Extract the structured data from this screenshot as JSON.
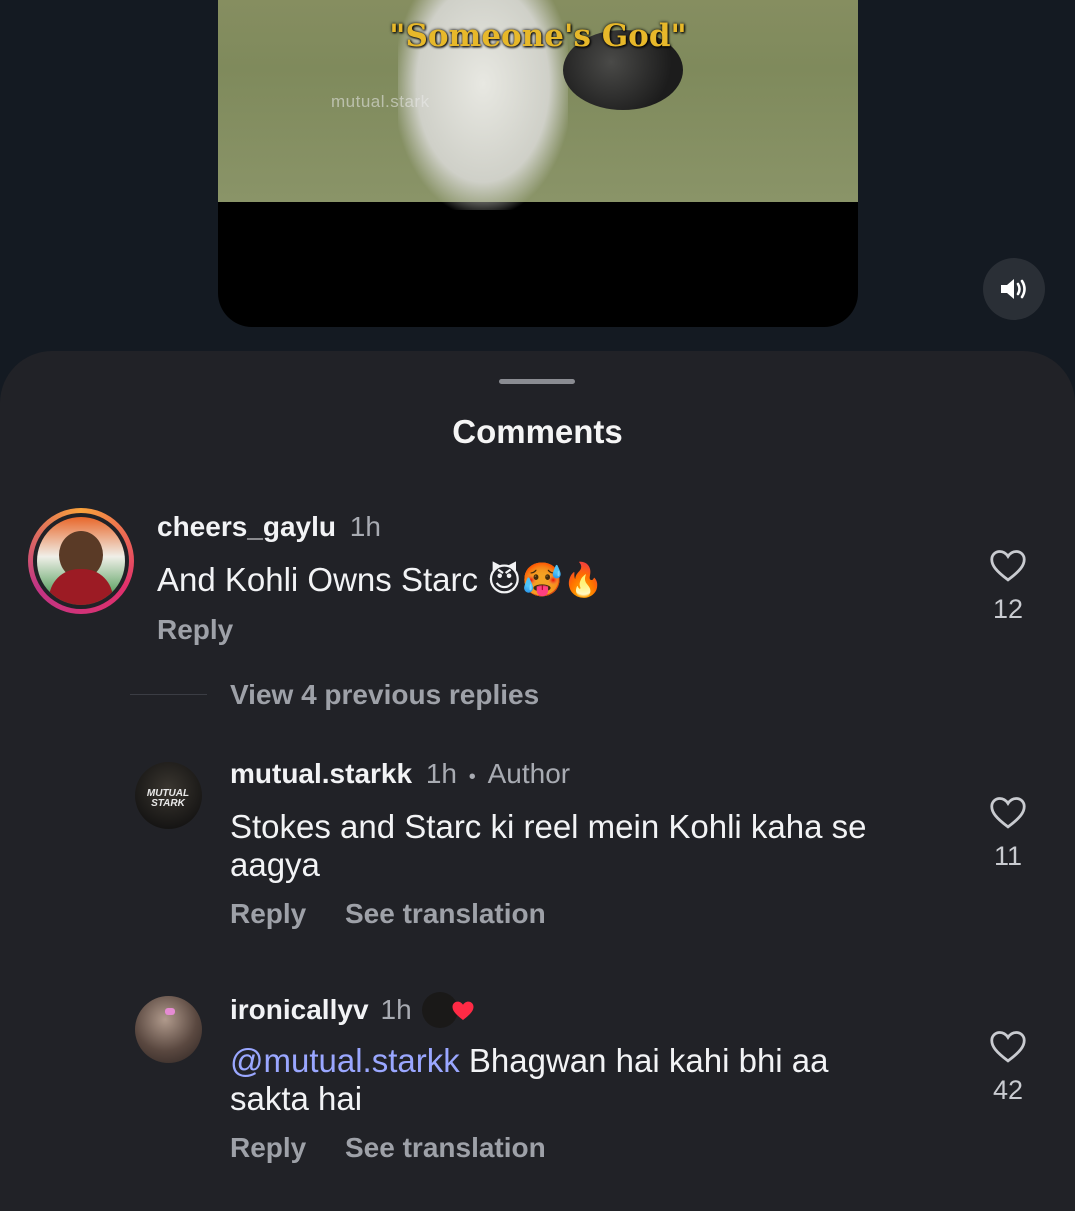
{
  "video": {
    "caption": "\"Someone's God\"",
    "watermark": "mutual.stark"
  },
  "sheet": {
    "title": "Comments"
  },
  "comments": [
    {
      "username": "cheers_gaylu",
      "time": "1h",
      "text": "And Kohli Owns Starc 😈🥵🔥",
      "reply_label": "Reply",
      "likes": "12"
    }
  ],
  "view_replies": "View 4 previous replies",
  "replies": [
    {
      "username": "mutual.starkk",
      "time": "1h",
      "separator": "•",
      "badge": "Author",
      "avatar_text": "MUTUAL STARK",
      "text_line1": "Stokes and Starc ki reel mein Kohli kaha se",
      "text_line2": "aagya",
      "reply_label": "Reply",
      "translate_label": "See translation",
      "likes": "11"
    },
    {
      "username": "ironicallyv",
      "time": "1h",
      "mention": "@mutual.starkk",
      "text_line1": " Bhagwan hai kahi bhi aa",
      "text_line2": "sakta hai",
      "reply_label": "Reply",
      "translate_label": "See translation",
      "likes": "42"
    }
  ],
  "colors": {
    "background": "#141a22",
    "sheet": "#212227",
    "mention": "#9aa7ff",
    "story_ring": [
      "#f9a23b",
      "#e1306c",
      "#c13584"
    ]
  },
  "icons": [
    "speaker-icon",
    "heart-icon"
  ]
}
